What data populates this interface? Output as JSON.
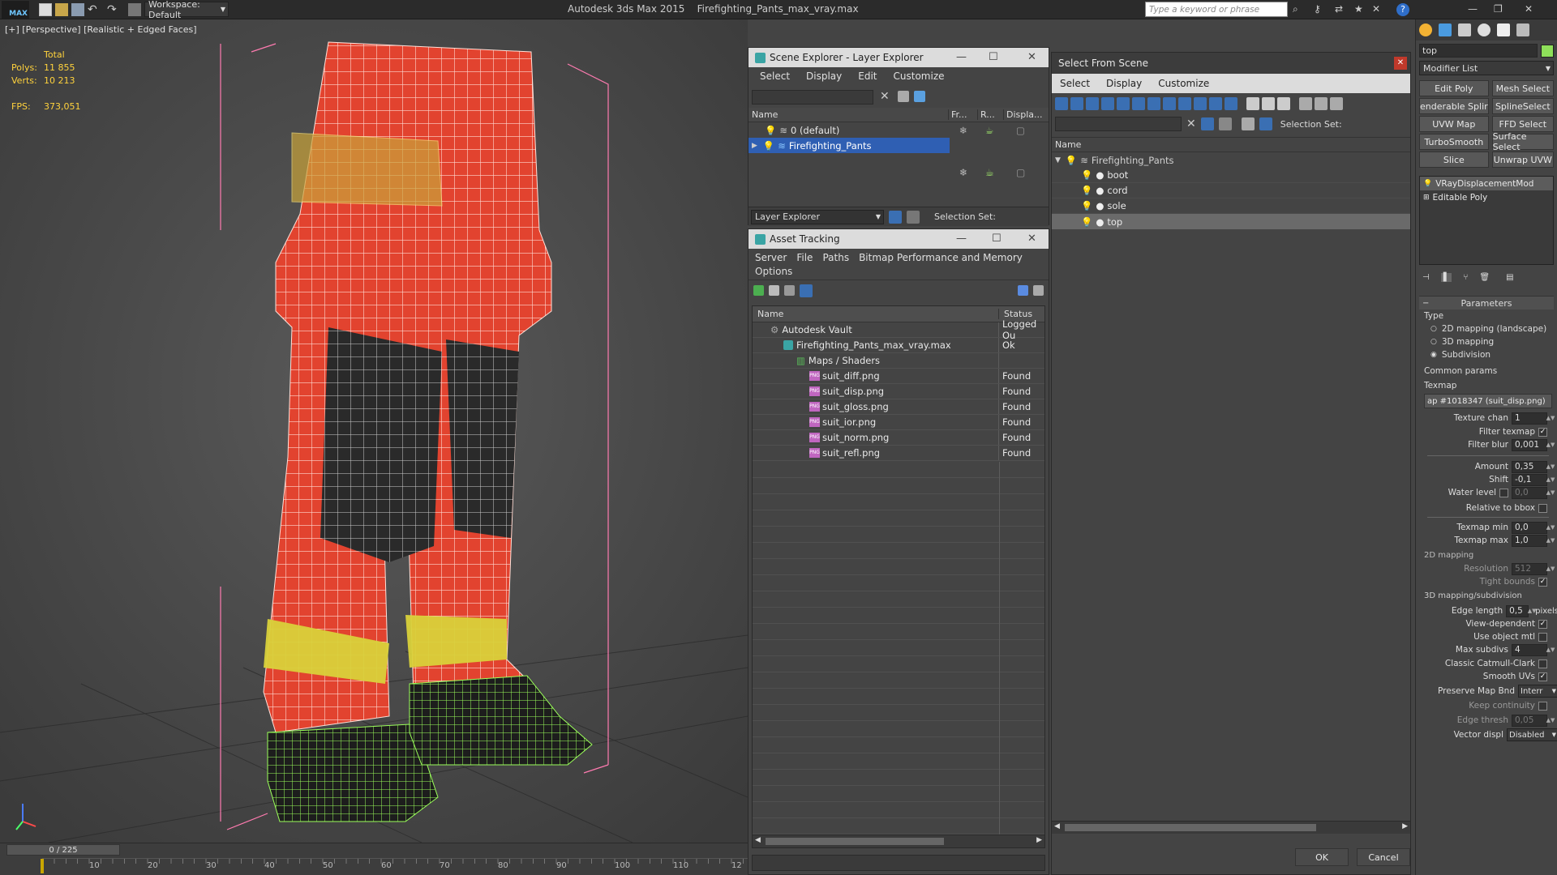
{
  "app": {
    "title": "Autodesk 3ds Max  2015",
    "file": "Firefighting_Pants_max_vray.max",
    "logo": "MAX",
    "workspace": "Workspace: Default",
    "search_placeholder": "Type a keyword or phrase"
  },
  "viewport": {
    "label": "[+] [Perspective] [Realistic + Edged Faces]",
    "stats": {
      "total_label": "Total",
      "polys_label": "Polys:",
      "polys": "11 855",
      "verts_label": "Verts:",
      "verts": "10 213",
      "fps_label": "FPS:",
      "fps": "373,051"
    }
  },
  "timeline": {
    "frame": "0 / 225",
    "ticks": [
      "10",
      "20",
      "30",
      "40",
      "50",
      "60",
      "70",
      "80",
      "90",
      "100",
      "110",
      "12"
    ]
  },
  "scene_explorer": {
    "title": "Scene Explorer - Layer Explorer",
    "menu": [
      "Select",
      "Display",
      "Edit",
      "Customize"
    ],
    "columns": [
      "Name",
      "Fr...",
      "R...",
      "Displa..."
    ],
    "rows": [
      "0 (default)",
      "Firefighting_Pants"
    ],
    "footer_dropdown": "Layer Explorer",
    "selection_set_label": "Selection Set:"
  },
  "asset_tracking": {
    "title": "Asset Tracking",
    "menu": [
      "Server",
      "File",
      "Paths",
      "Bitmap Performance and Memory"
    ],
    "menu2": "Options",
    "columns": [
      "Name",
      "Status"
    ],
    "rows": [
      {
        "name": "Autodesk Vault",
        "status": "Logged Ou"
      },
      {
        "name": "Firefighting_Pants_max_vray.max",
        "status": "Ok"
      },
      {
        "name": "Maps / Shaders",
        "status": ""
      },
      {
        "name": "suit_diff.png",
        "status": "Found"
      },
      {
        "name": "suit_disp.png",
        "status": "Found"
      },
      {
        "name": "suit_gloss.png",
        "status": "Found"
      },
      {
        "name": "suit_ior.png",
        "status": "Found"
      },
      {
        "name": "suit_norm.png",
        "status": "Found"
      },
      {
        "name": "suit_refl.png",
        "status": "Found"
      }
    ]
  },
  "select_from_scene": {
    "title": "Select From Scene",
    "menu": [
      "Select",
      "Display",
      "Customize"
    ],
    "selection_set_label": "Selection Set:",
    "name_col": "Name",
    "root": "Firefighting_Pants",
    "children": [
      "boot",
      "cord",
      "sole",
      "top"
    ],
    "ok": "OK",
    "cancel": "Cancel"
  },
  "command_panel": {
    "object_name": "top",
    "modifier_list": "Modifier List",
    "mod_buttons": [
      "Edit Poly",
      "Mesh Select",
      "enderable Splir",
      "SplineSelect",
      "UVW Map",
      "FFD Select",
      "TurboSmooth",
      "Surface Select",
      "Slice",
      "Unwrap UVW"
    ],
    "stack": [
      "VRayDisplacementMod",
      "Editable Poly"
    ],
    "parameters_title": "Parameters",
    "type_label": "Type",
    "type_options": [
      "2D mapping (landscape)",
      "3D mapping",
      "Subdivision"
    ],
    "common_params": "Common params",
    "texmap_label": "Texmap",
    "texmap_value": "ap #1018347 (suit_disp.png)",
    "texture_chan_label": "Texture chan",
    "texture_chan": "1",
    "filter_texmap": "Filter texmap",
    "filter_blur_label": "Filter blur",
    "filter_blur": "0,001",
    "amount_label": "Amount",
    "amount": "0,35",
    "shift_label": "Shift",
    "shift": "-0,1",
    "water_level_label": "Water level",
    "water_level": "0,0",
    "relative_bbox": "Relative to bbox",
    "texmap_min_label": "Texmap min",
    "texmap_min": "0,0",
    "texmap_max_label": "Texmap max",
    "texmap_max": "1,0",
    "mapping2d": "2D mapping",
    "resolution_label": "Resolution",
    "resolution": "512",
    "tight_bounds": "Tight bounds",
    "mapping3d": "3D mapping/subdivision",
    "edge_length_label": "Edge length",
    "edge_length": "0,5",
    "pixels": "pixels",
    "view_dependent": "View-dependent",
    "use_object_mtl": "Use object mtl",
    "max_subdivs_label": "Max subdivs",
    "max_subdivs": "4",
    "classic_catmull": "Classic Catmull-Clark",
    "smooth_uvs": "Smooth UVs",
    "preserve_map_bnd": "Preserve Map Bnd",
    "preserve_value": "Interr",
    "keep_continuity": "Keep continuity",
    "edge_thresh_label": "Edge thresh",
    "edge_thresh": "0,05",
    "vector_displ_label": "Vector displ",
    "vector_displ": "Disabled"
  }
}
